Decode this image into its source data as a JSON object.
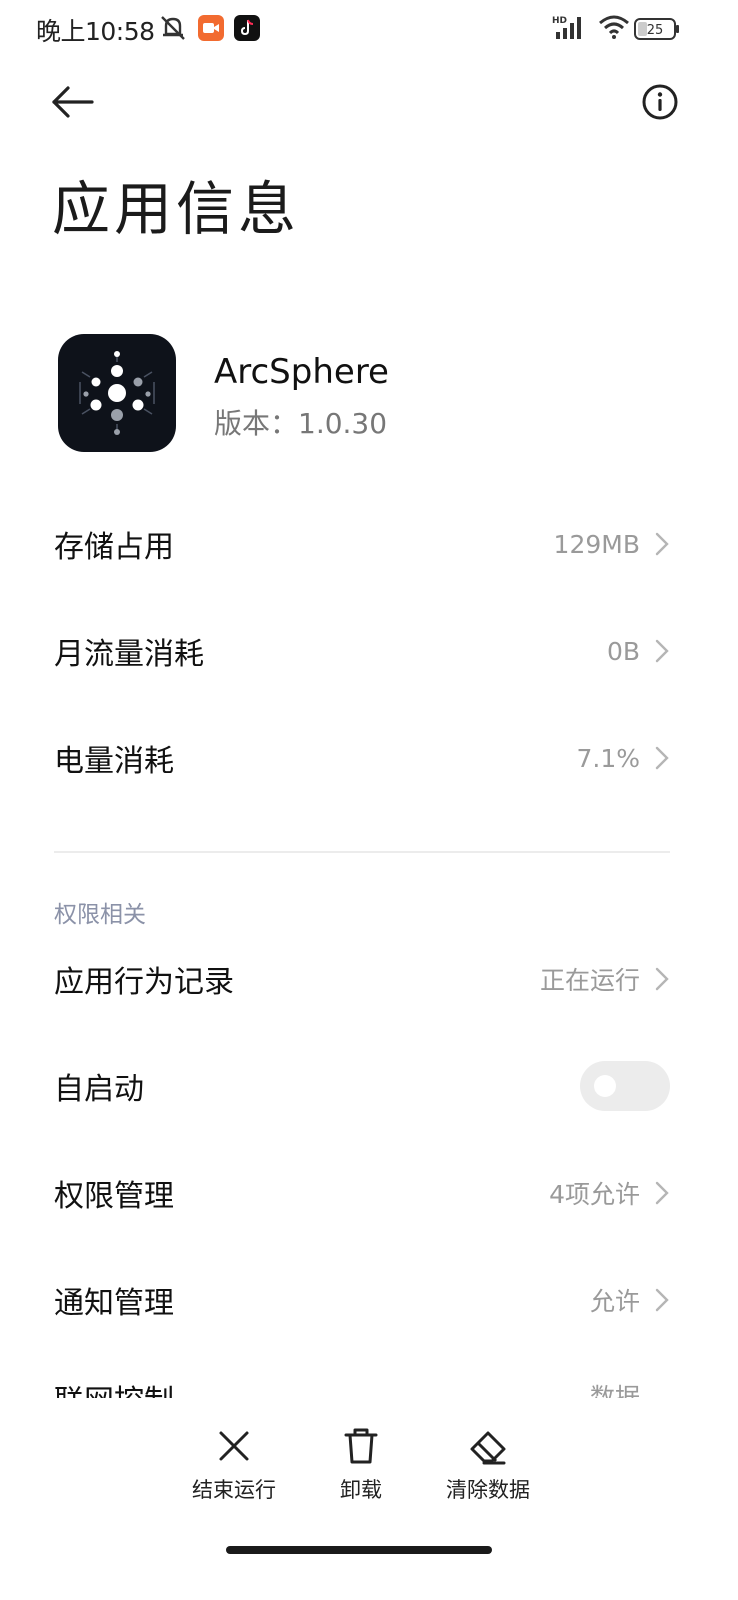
{
  "status_bar": {
    "time": "晚上10:58",
    "battery": "25",
    "network_tag": "HD"
  },
  "page": {
    "title": "应用信息"
  },
  "app": {
    "name": "ArcSphere",
    "version": "版本：1.0.30"
  },
  "rows_top": [
    {
      "label": "存储占用",
      "value": "129MB"
    },
    {
      "label": "月流量消耗",
      "value": "0B"
    },
    {
      "label": "电量消耗",
      "value": "7.1%"
    }
  ],
  "section": {
    "title": "权限相关"
  },
  "rows_permissions": [
    {
      "label": "应用行为记录",
      "value": "正在运行"
    },
    {
      "label": "自启动",
      "toggle": false
    },
    {
      "label": "权限管理",
      "value": "4项允许"
    },
    {
      "label": "通知管理",
      "value": "允许"
    }
  ],
  "partial_row": {
    "label": "联网控制",
    "value": "数据"
  },
  "bottom_actions": [
    {
      "label": "结束运行",
      "icon": "close-icon"
    },
    {
      "label": "卸载",
      "icon": "trash-icon"
    },
    {
      "label": "清除数据",
      "icon": "eraser-icon"
    }
  ],
  "colors": {
    "value_gray": "#9a9a9a",
    "section_label": "#8b92a8",
    "toggle_off": "#ececec"
  }
}
